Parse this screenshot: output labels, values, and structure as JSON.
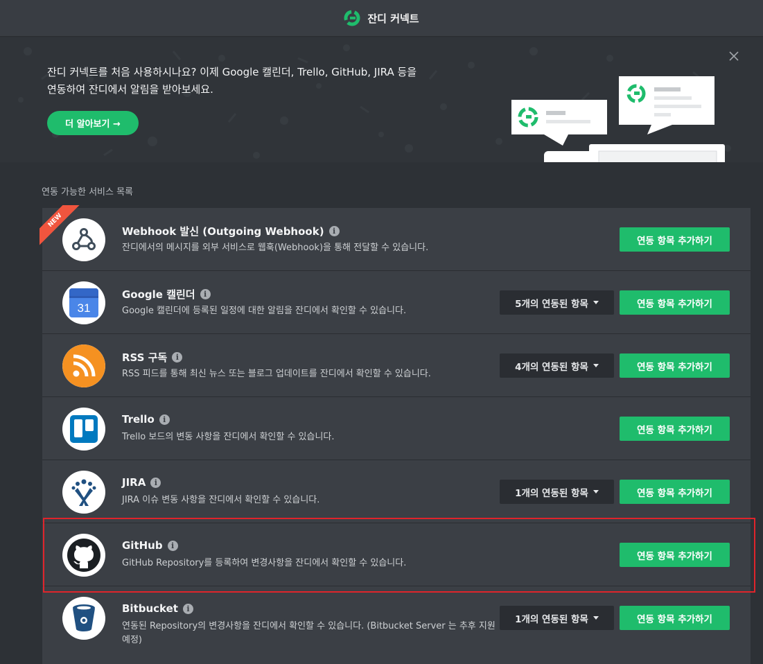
{
  "header": {
    "title": "잔디 커넥트"
  },
  "banner": {
    "message_line1": "잔디 커넥트를 처음 사용하시나요? 이제 Google 캘린더, Trello, GitHub, JIRA 등을",
    "message_line2": "연동하여 잔디에서 알림을 받아보세요.",
    "learn_more": "더 알아보기 →"
  },
  "section": {
    "title": "연동 가능한 서비스 목록"
  },
  "add_label": "연동 항목 추가하기",
  "colors": {
    "accent": "#1fbc6c",
    "ribbon": "#f0553e",
    "highlight": "#e0242b"
  },
  "services": [
    {
      "name": "Webhook 발신 (Outgoing Webhook)",
      "desc": "잔디에서의 메시지를 외부 서비스로 웹훅(Webhook)을 통해 전달할 수 있습니다.",
      "badge": "NEW",
      "icon": "webhook-icon"
    },
    {
      "name": "Google 캘린더",
      "desc": "Google 캘린더에 등록된 일정에 대한 알림을 잔디에서 확인할 수 있습니다.",
      "linked": "5개의 연동된 항목",
      "icon": "google-calendar-icon",
      "calendar_day": "31"
    },
    {
      "name": "RSS 구독",
      "desc": "RSS 피드를 통해 최신 뉴스 또는 블로그 업데이트를 잔디에서 확인할 수 있습니다.",
      "linked": "4개의 연동된 항목",
      "icon": "rss-icon"
    },
    {
      "name": "Trello",
      "desc": "Trello 보드의 변동 사항을 잔디에서 확인할 수 있습니다.",
      "icon": "trello-icon"
    },
    {
      "name": "JIRA",
      "desc": "JIRA 이슈 변동 사항을 잔디에서 확인할 수 있습니다.",
      "linked": "1개의 연동된 항목",
      "icon": "jira-icon"
    },
    {
      "name": "GitHub",
      "desc": "GitHub Repository를 등록하여 변경사항을 잔디에서 확인할 수 있습니다.",
      "icon": "github-icon"
    },
    {
      "name": "Bitbucket",
      "desc": "연동된 Repository의 변경사항을 잔디에서 확인할 수 있습니다. (Bitbucket Server 는 추후 지원 예정)",
      "linked": "1개의 연동된 항목",
      "icon": "bitbucket-icon"
    }
  ]
}
